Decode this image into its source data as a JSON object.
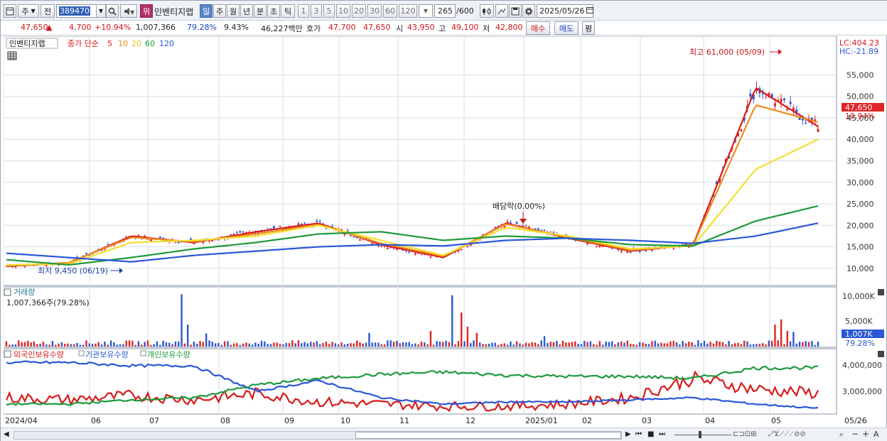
{
  "toolbar": {
    "market_label": "주",
    "prev_label": "전",
    "stock_code": "389470",
    "brand_tag": "위",
    "stock_name": "인벤티지랩",
    "periods": [
      "일",
      "주",
      "월",
      "년",
      "분",
      "초",
      "틱"
    ],
    "active_period": "일",
    "intervals": [
      "1",
      "3",
      "5",
      "10",
      "20",
      "30",
      "60",
      "120"
    ],
    "count_value": "265",
    "count_total": "/600",
    "date": "2025/05/26"
  },
  "quote": {
    "price": "47,650",
    "change_arrow": "▲",
    "change": "4,700",
    "change_pct": "+10.94%",
    "volume": "1,007,366",
    "volume_ratio": "79.28%",
    "turnover": "9.43%",
    "amount": "46,227백만",
    "ask_label": "호가",
    "ask": "47,700",
    "bid": "47,650",
    "open_label": "시",
    "open": "43,950",
    "high_label": "고",
    "high": "49,100",
    "low_label": "저",
    "low": "42,800",
    "buy_label": "매수",
    "sell_label": "매도",
    "avg_label": "평"
  },
  "price_panel": {
    "title": "인벤티지랩",
    "legend_prefix": "종가 단순",
    "ma_periods": [
      "5",
      "10",
      "20",
      "60",
      "120"
    ],
    "ma_colors": [
      "#d81b1b",
      "#f08a1c",
      "#f2e030",
      "#1e9a3c",
      "#2a56d8"
    ],
    "lc": "LC:404.23",
    "hc": "HC:-21.89",
    "y_ticks": [
      "55,000",
      "50,000",
      "45,000",
      "40,000",
      "35,000",
      "30,000",
      "25,000",
      "20,000",
      "15,000",
      "10,000"
    ],
    "current_price_tag": "47,650",
    "current_pct_tag": "10.94%",
    "max_annotation": "최고 61,000 (05/09)",
    "min_annotation": "최저 9,450 (06/19)",
    "dividend_annotation": "배당락(0.00%)"
  },
  "volume_panel": {
    "title": "거래량",
    "value_text": "1,007,366주(79.28%)",
    "y_ticks": [
      "10,000K",
      "5,000K"
    ],
    "current_tag": "1,007K",
    "current_pct": "79.28%"
  },
  "holding_panel": {
    "series": [
      {
        "name": "외국인보유수량",
        "color": "#d81b1b"
      },
      {
        "name": "기관보유수량",
        "color": "#2a56d8"
      },
      {
        "name": "개인보유수량",
        "color": "#1e9a3c"
      }
    ],
    "y_ticks": [
      "4,000,000",
      "3,000,000"
    ]
  },
  "x_axis": {
    "labels": [
      "2024/04",
      "06",
      "07",
      "08",
      "09",
      "10",
      "11",
      "12",
      "2025/01",
      "02",
      "03",
      "04",
      "05",
      "05/26"
    ]
  },
  "chart_data": {
    "type": "line",
    "title": "인벤티지랩",
    "x": [
      "2024/04",
      "06",
      "07",
      "08",
      "09",
      "10",
      "11",
      "12",
      "2025/01",
      "02",
      "03",
      "04",
      "05",
      "05/26"
    ],
    "ylim": [
      8000,
      61000
    ],
    "series": [
      {
        "name": "MA5",
        "values": [
          10500,
          11200,
          17500,
          16000,
          18500,
          20500,
          15500,
          12500,
          20500,
          17000,
          14000,
          15500,
          52000,
          43000
        ]
      },
      {
        "name": "MA10",
        "values": [
          10600,
          11300,
          17200,
          16200,
          18000,
          20200,
          15800,
          12800,
          20300,
          17200,
          14200,
          15400,
          48000,
          44000
        ]
      },
      {
        "name": "MA20",
        "values": [
          10800,
          11000,
          16000,
          16500,
          17500,
          20000,
          16500,
          13000,
          19500,
          17500,
          14500,
          15200,
          33000,
          40000
        ]
      },
      {
        "name": "MA60",
        "values": [
          12000,
          10800,
          12500,
          14500,
          16000,
          18000,
          18500,
          16500,
          17500,
          17000,
          15500,
          15200,
          21000,
          24500
        ]
      },
      {
        "name": "MA120",
        "values": [
          13500,
          12500,
          11500,
          13000,
          14000,
          15000,
          15500,
          15200,
          16500,
          17000,
          16500,
          15800,
          17500,
          20500
        ]
      }
    ],
    "high": {
      "value": 61000,
      "date": "05/09"
    },
    "low": {
      "value": 9450,
      "date": "06/19"
    },
    "volume_max": 10000000
  }
}
